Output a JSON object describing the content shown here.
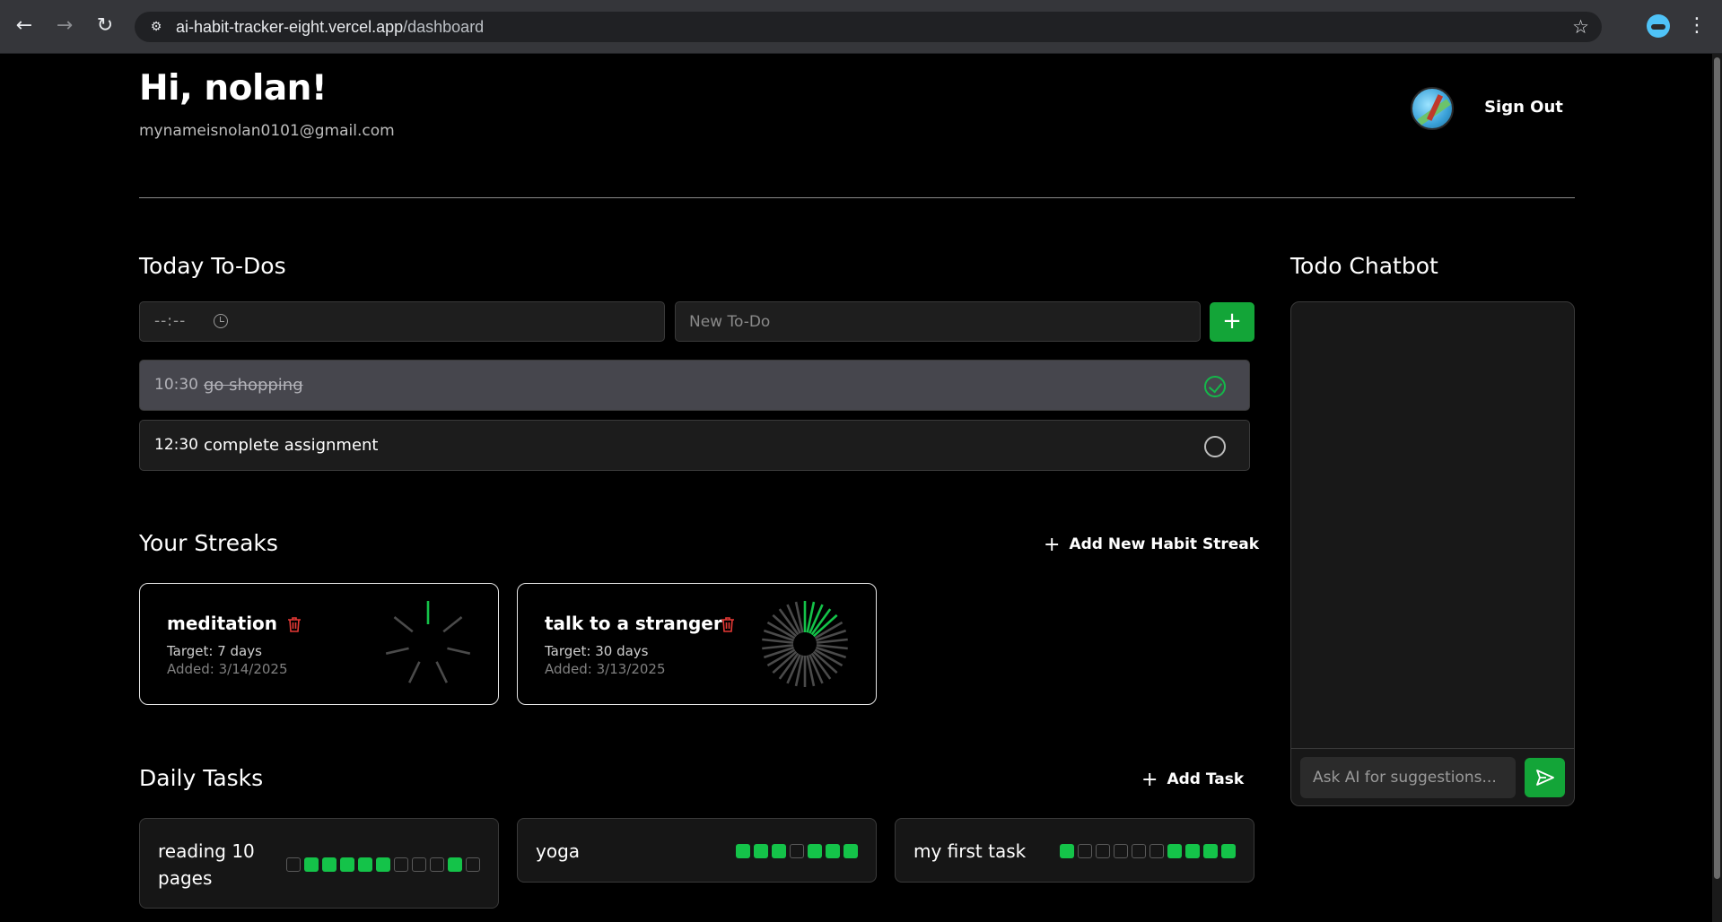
{
  "browser": {
    "url_host": "ai-habit-tracker-eight.vercel.app",
    "url_path": "/dashboard",
    "back_icon": "arrow-left-icon",
    "forward_icon": "arrow-right-icon",
    "reload_icon": "reload-icon",
    "bookmark_icon": "star-icon",
    "menu_icon": "kebab-menu-icon"
  },
  "header": {
    "greeting": "Hi, nolan!",
    "email": "mynameisnolan0101@gmail.com",
    "sign_out": "Sign Out"
  },
  "todos": {
    "title": "Today To-Dos",
    "time_placeholder": "--:--",
    "new_placeholder": "New To-Do",
    "add_label": "+",
    "items": [
      {
        "time": "10:30",
        "text": "go shopping",
        "done": true
      },
      {
        "time": "12:30",
        "text": "complete assignment",
        "done": false
      }
    ]
  },
  "streaks": {
    "title": "Your Streaks",
    "add_label": "Add New Habit Streak",
    "items": [
      {
        "name": "meditation",
        "target": "Target: 7 days",
        "added": "Added: 3/14/2025",
        "target_days": 7,
        "completed_days": 1
      },
      {
        "name": "talk to a stranger",
        "target": "Target: 30 days",
        "added": "Added: 3/13/2025",
        "target_days": 30,
        "completed_days": 5
      }
    ]
  },
  "daily_tasks": {
    "title": "Daily Tasks",
    "add_label": "Add Task",
    "items": [
      {
        "name": "reading 10 pages",
        "days": [
          0,
          1,
          1,
          1,
          1,
          1,
          0,
          0,
          0,
          1,
          0
        ]
      },
      {
        "name": "yoga",
        "days": [
          1,
          1,
          1,
          0,
          1,
          1,
          1
        ]
      },
      {
        "name": "my first task",
        "days": [
          1,
          0,
          0,
          0,
          0,
          0,
          1,
          1,
          1,
          1
        ]
      }
    ]
  },
  "chatbot": {
    "title": "Todo Chatbot",
    "placeholder": "Ask AI for suggestions...",
    "send_icon": "send-icon"
  },
  "colors": {
    "accent_green": "#13a538",
    "dot_green": "#14c349",
    "danger_red": "#e53935"
  }
}
